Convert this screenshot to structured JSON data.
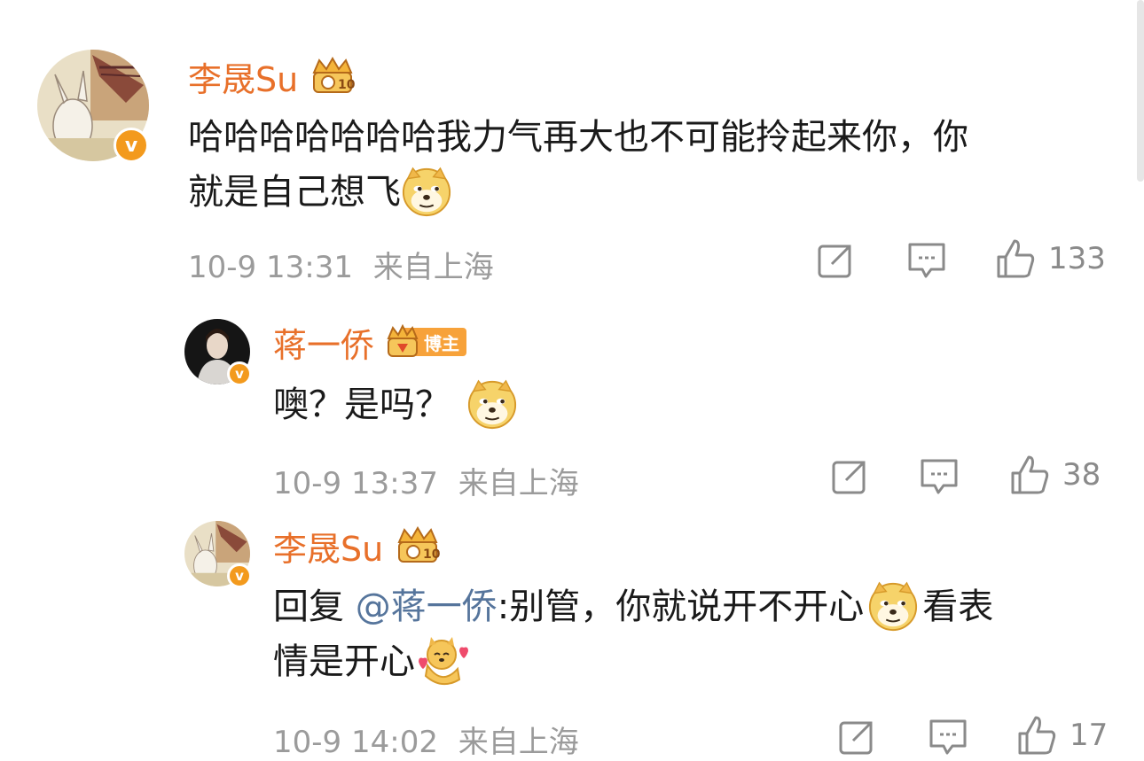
{
  "comments": [
    {
      "author": "李晟Su",
      "text_lines": [
        "哈哈哈哈哈哈哈我力气再大也不可能拎起来你，你",
        "就是自己想飞"
      ],
      "time": "10-9 13:31",
      "location": "来自上海",
      "likes": "133"
    },
    {
      "author": "蒋一侨",
      "badge_label": "博主",
      "text": "噢？是吗？",
      "time": "10-9 13:37",
      "location": "来自上海",
      "likes": "38"
    },
    {
      "author": "李晟Su",
      "reply_prefix": "回复 ",
      "mention": "@蒋一侨",
      "text_line1": ":别管，你就说开不开心",
      "text_line1_end": "看表",
      "text_line2": "情是开心",
      "time": "10-9 14:02",
      "location": "来自上海",
      "likes": "17"
    }
  ],
  "icons": {
    "repost": "repost-icon",
    "comment": "comment-icon",
    "like": "like-icon",
    "verified": "verified-v-icon",
    "member": "crown-member-icon",
    "emoji_doge": "doge-emoji",
    "emoji_heart_doge": "heart-doge-emoji"
  },
  "colors": {
    "name": "#e8702a",
    "mention": "#56759c",
    "meta": "#9b9b9b",
    "badge": "#f39a1d"
  }
}
